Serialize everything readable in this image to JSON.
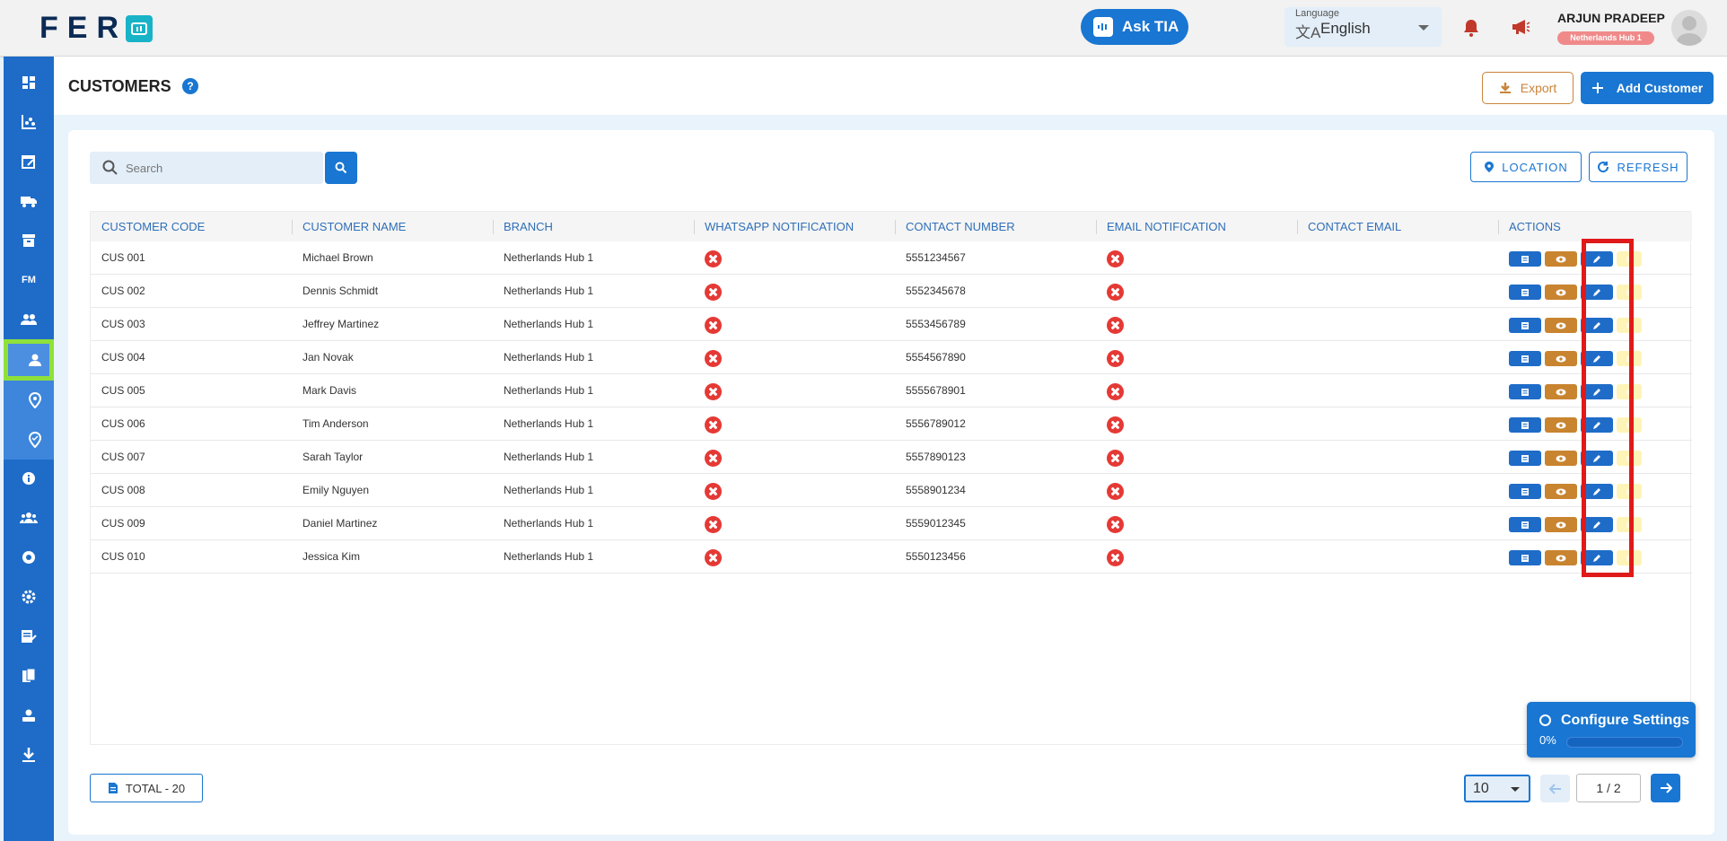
{
  "header": {
    "logo_text": "FER",
    "ask_tia_label": "Ask TIA",
    "language": {
      "caption": "Language",
      "value": "English"
    },
    "user": {
      "name": "ARJUN PRADEEP",
      "branch_badge": "Netherlands Hub 1"
    }
  },
  "page": {
    "title": "CUSTOMERS",
    "help_glyph": "?",
    "export_label": "Export",
    "add_customer_label": "Add Customer"
  },
  "toolbar": {
    "search_placeholder": "Search",
    "location_label": "LOCATION",
    "refresh_label": "REFRESH"
  },
  "table": {
    "columns": [
      "CUSTOMER CODE",
      "CUSTOMER NAME",
      "BRANCH",
      "WHATSAPP NOTIFICATION",
      "CONTACT NUMBER",
      "EMAIL NOTIFICATION",
      "CONTACT EMAIL",
      "ACTIONS"
    ],
    "rows": [
      {
        "code": "CUS 001",
        "name": "Michael Brown",
        "branch": "Netherlands Hub 1",
        "whatsapp": false,
        "contact_number": "5551234567",
        "email_notification": false,
        "contact_email": ""
      },
      {
        "code": "CUS 002",
        "name": "Dennis Schmidt",
        "branch": "Netherlands Hub 1",
        "whatsapp": false,
        "contact_number": "5552345678",
        "email_notification": false,
        "contact_email": ""
      },
      {
        "code": "CUS 003",
        "name": "Jeffrey Martinez",
        "branch": "Netherlands Hub 1",
        "whatsapp": false,
        "contact_number": "5553456789",
        "email_notification": false,
        "contact_email": ""
      },
      {
        "code": "CUS 004",
        "name": "Jan Novak",
        "branch": "Netherlands Hub 1",
        "whatsapp": false,
        "contact_number": "5554567890",
        "email_notification": false,
        "contact_email": ""
      },
      {
        "code": "CUS 005",
        "name": "Mark Davis",
        "branch": "Netherlands Hub 1",
        "whatsapp": false,
        "contact_number": "5555678901",
        "email_notification": false,
        "contact_email": ""
      },
      {
        "code": "CUS 006",
        "name": "Tim Anderson",
        "branch": "Netherlands Hub 1",
        "whatsapp": false,
        "contact_number": "5556789012",
        "email_notification": false,
        "contact_email": ""
      },
      {
        "code": "CUS 007",
        "name": "Sarah Taylor",
        "branch": "Netherlands Hub 1",
        "whatsapp": false,
        "contact_number": "5557890123",
        "email_notification": false,
        "contact_email": ""
      },
      {
        "code": "CUS 008",
        "name": "Emily Nguyen",
        "branch": "Netherlands Hub 1",
        "whatsapp": false,
        "contact_number": "5558901234",
        "email_notification": false,
        "contact_email": ""
      },
      {
        "code": "CUS 009",
        "name": "Daniel Martinez",
        "branch": "Netherlands Hub 1",
        "whatsapp": false,
        "contact_number": "5559012345",
        "email_notification": false,
        "contact_email": ""
      },
      {
        "code": "CUS 010",
        "name": "Jessica Kim",
        "branch": "Netherlands Hub 1",
        "whatsapp": false,
        "contact_number": "5550123456",
        "email_notification": false,
        "contact_email": ""
      }
    ],
    "row_actions": [
      "details-icon",
      "view-icon",
      "edit-icon",
      "extra-icon"
    ]
  },
  "footer": {
    "total_label": "TOTAL  - 20",
    "page_size": "10",
    "page_indicator": "1  /  2"
  },
  "config_widget": {
    "title": "Configure Settings",
    "progress_text": "0%",
    "progress": 0
  },
  "sidebar": {
    "items": [
      "dashboard-icon",
      "analytics-icon",
      "calendar-edit-icon",
      "delivery-truck-icon",
      "archive-icon",
      "fm-icon",
      "people-icon",
      "customer-icon",
      "location-pin-icon",
      "location-check-icon",
      "info-icon",
      "groups-icon",
      "support-icon",
      "settings-icon",
      "notes-edit-icon",
      "documents-icon",
      "user-admin-icon",
      "download-icon"
    ],
    "fm_text": "FM",
    "active": "customer-icon"
  },
  "colors": {
    "primary": "#1976d2",
    "sidebar": "#1e6cc8",
    "export_accent": "#c9843a",
    "error_red": "#e53935",
    "active_highlight": "#8ee03a",
    "annotation_box": "#e01a1a"
  }
}
